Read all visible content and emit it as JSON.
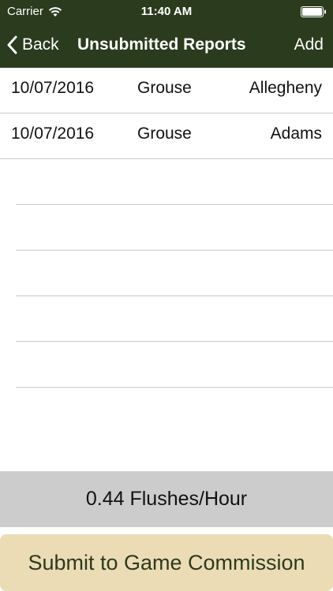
{
  "status_bar": {
    "carrier": "Carrier",
    "time": "11:40 AM",
    "wifi_icon": "wifi-icon",
    "battery_icon": "battery-icon"
  },
  "nav": {
    "back_label": "Back",
    "title": "Unsubmitted Reports",
    "add_label": "Add",
    "background_color": "#2b3b1d"
  },
  "reports": [
    {
      "date": "10/07/2016",
      "species": "Grouse",
      "county": "Allegheny"
    },
    {
      "date": "10/07/2016",
      "species": "Grouse",
      "county": "Adams"
    }
  ],
  "rate": {
    "text": "0.44 Flushes/Hour"
  },
  "submit": {
    "label": "Submit to Game Commission",
    "color": "#ecdcb6"
  }
}
